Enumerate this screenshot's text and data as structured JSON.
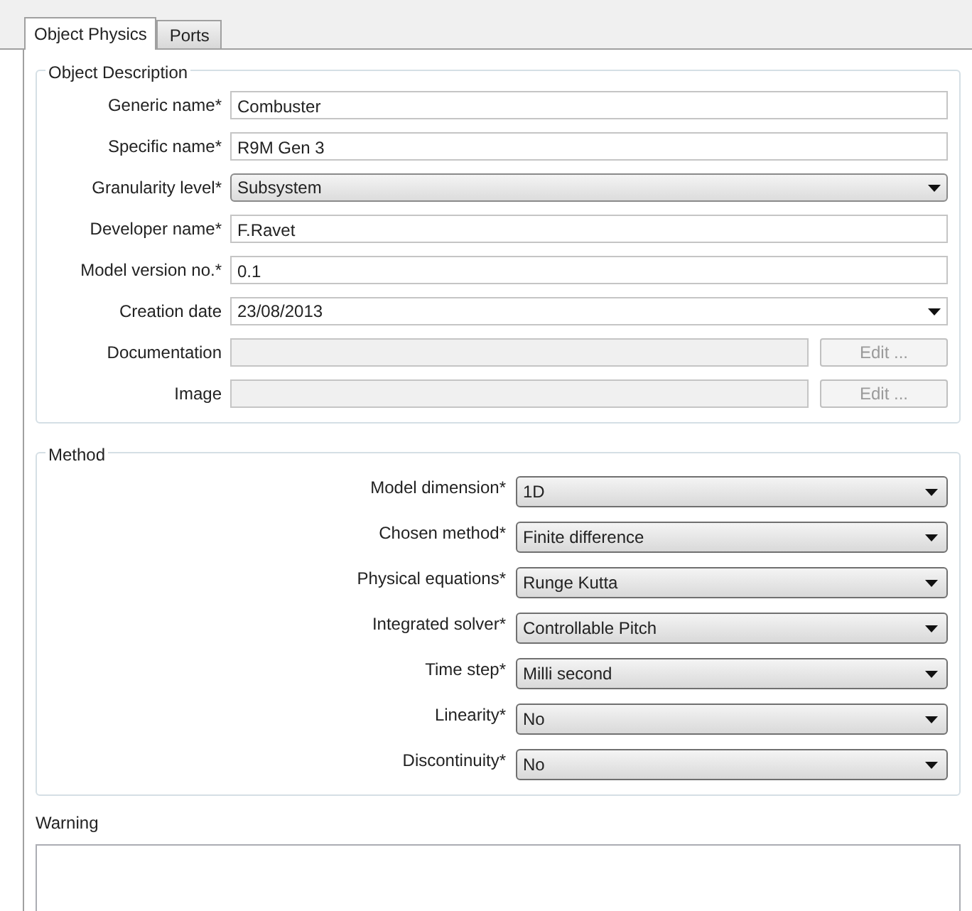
{
  "tabs": [
    {
      "label": "Object Physics",
      "selected": true
    },
    {
      "label": "Ports",
      "selected": false
    }
  ],
  "object_description": {
    "title": "Object Description",
    "fields": [
      {
        "label": "Generic name*",
        "kind": "text",
        "value": "Combuster"
      },
      {
        "label": "Specific name*",
        "kind": "text",
        "value": "R9M Gen 3"
      },
      {
        "label": "Granularity level*",
        "kind": "combo",
        "value": "Subsystem"
      },
      {
        "label": "Developer name*",
        "kind": "text",
        "value": "F.Ravet"
      },
      {
        "label": "Model version no.*",
        "kind": "text",
        "value": "0.1"
      },
      {
        "label": "Creation date",
        "kind": "date",
        "value": "23/08/2013"
      },
      {
        "label": "Documentation",
        "kind": "file",
        "button": "Edit ...",
        "disabled": true
      },
      {
        "label": "Image",
        "kind": "file",
        "button": "Edit ...",
        "disabled": true
      }
    ]
  },
  "method": {
    "title": "Method",
    "fields": [
      {
        "label": "Model dimension*",
        "value": "1D"
      },
      {
        "label": "Chosen method*",
        "value": "Finite difference"
      },
      {
        "label": "Physical equations*",
        "value": "Runge Kutta"
      },
      {
        "label": "Integrated solver*",
        "value": "Controllable Pitch"
      },
      {
        "label": "Time step*",
        "value": "Milli second"
      },
      {
        "label": "Linearity*",
        "value": "No"
      },
      {
        "label": "Discontinuity*",
        "value": "No"
      }
    ]
  },
  "warning": {
    "title": "Warning"
  }
}
